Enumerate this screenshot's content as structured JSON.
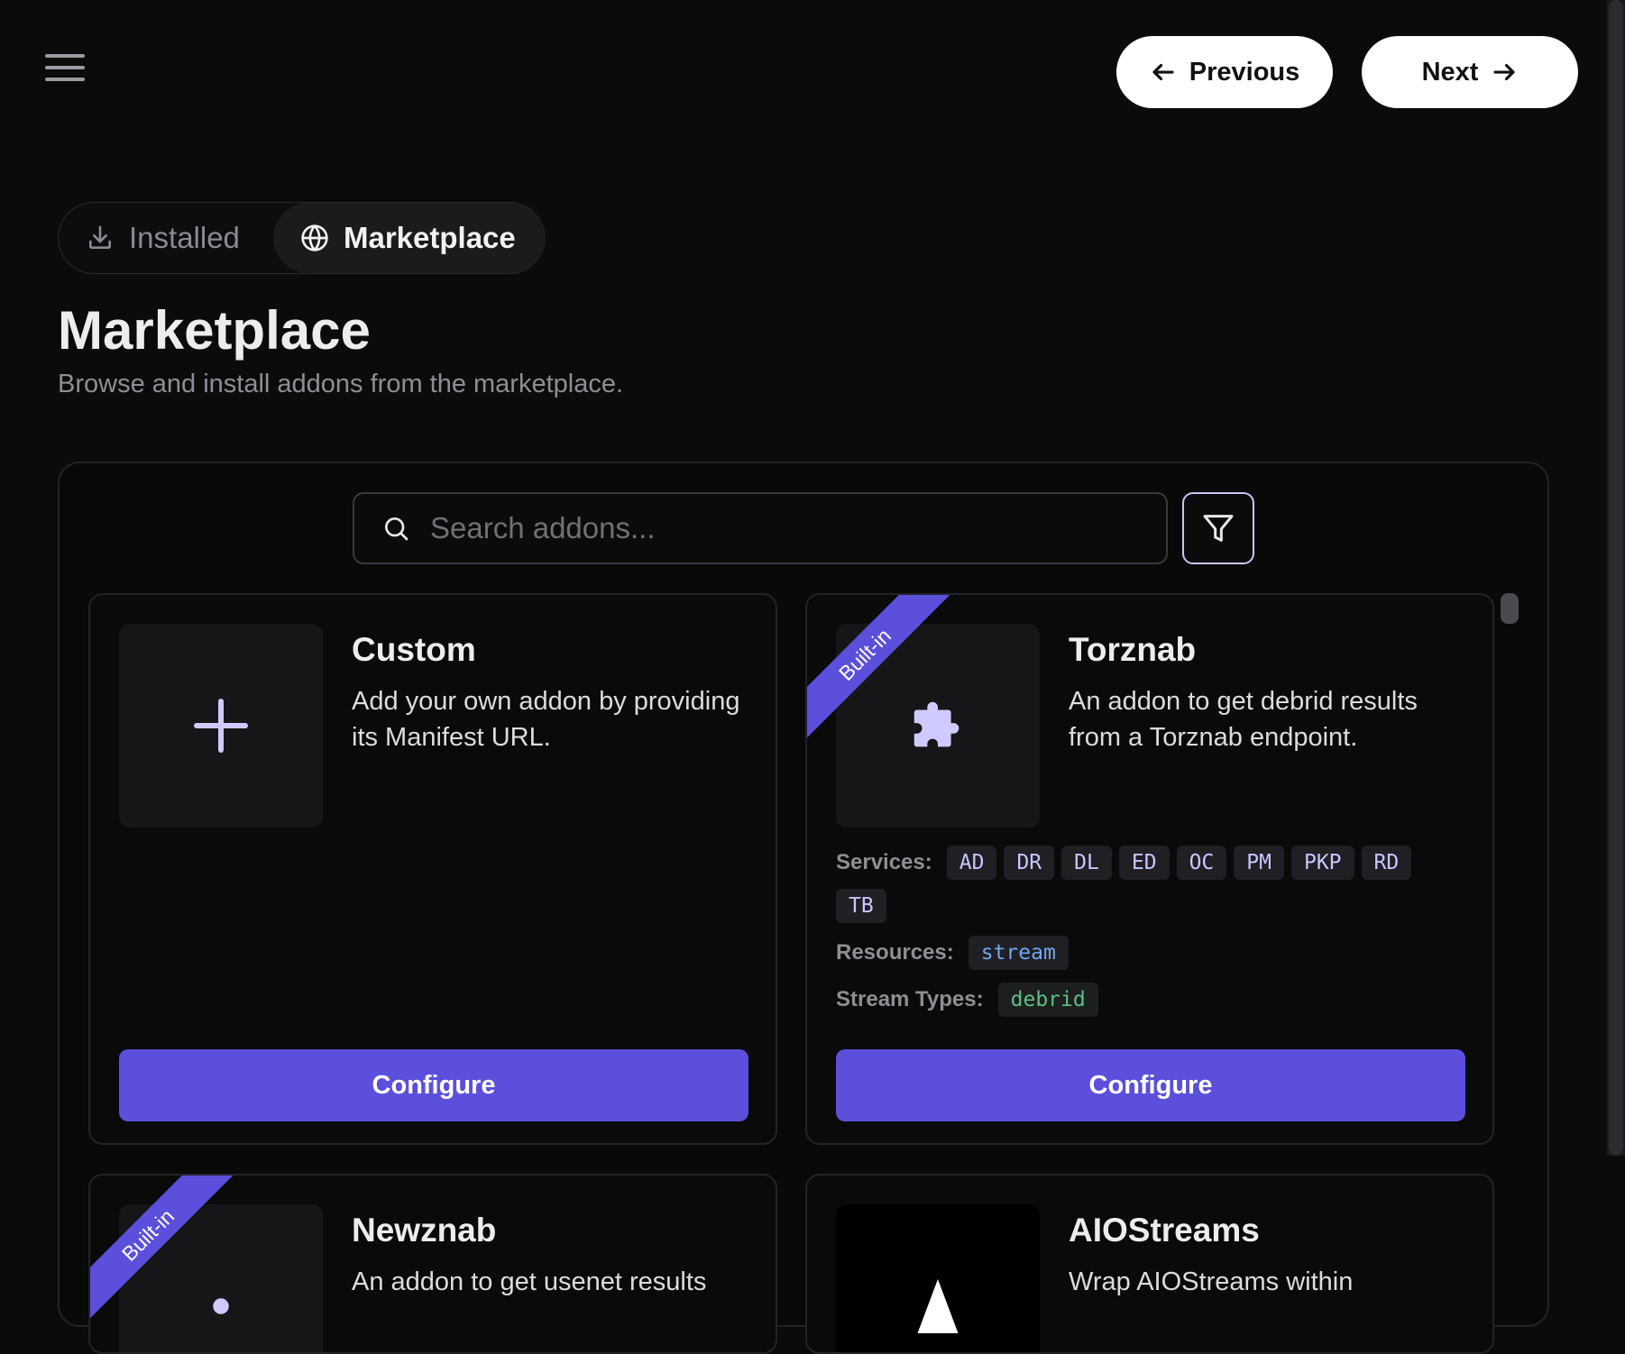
{
  "nav": {
    "previous_label": "Previous",
    "next_label": "Next"
  },
  "tabs": [
    {
      "label": "Installed",
      "icon": "download-icon",
      "active": false
    },
    {
      "label": "Marketplace",
      "icon": "globe-icon",
      "active": true
    }
  ],
  "page": {
    "title": "Marketplace",
    "subtitle": "Browse and install addons from the marketplace."
  },
  "search": {
    "placeholder": "Search addons...",
    "value": ""
  },
  "cards": [
    {
      "title": "Custom",
      "description": "Add your own addon by providing its Manifest URL.",
      "icon": "plus-icon",
      "builtin": false,
      "button": "Configure"
    },
    {
      "title": "Torznab",
      "description": "An addon to get debrid results from a Torznab endpoint.",
      "icon": "puzzle-icon",
      "builtin": true,
      "badge": "Built-in",
      "services_label": "Services:",
      "services": [
        "AD",
        "DR",
        "DL",
        "ED",
        "OC",
        "PM",
        "PKP",
        "RD",
        "TB"
      ],
      "resources_label": "Resources:",
      "resources": [
        "stream"
      ],
      "stream_types_label": "Stream Types:",
      "stream_types": [
        "debrid"
      ],
      "button": "Configure"
    },
    {
      "title": "Newznab",
      "description": "An addon to get usenet results",
      "icon": "puzzle-icon",
      "builtin": true,
      "badge": "Built-in"
    },
    {
      "title": "AIOStreams",
      "description": "Wrap AIOStreams within",
      "icon": "aiostreams-logo-icon",
      "builtin": false
    }
  ],
  "colors": {
    "accent": "#5b4fdc",
    "background": "#0b0b0c",
    "chip_service": "#c8c6ff",
    "chip_resource": "#6fa8f0",
    "chip_stream_type": "#5fbf84"
  }
}
